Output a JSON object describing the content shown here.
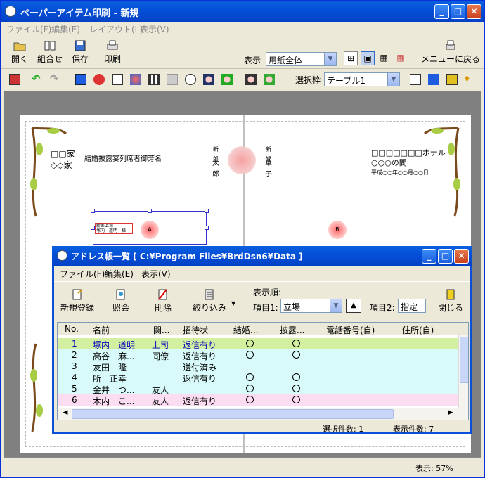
{
  "app": {
    "title": "ペーパーアイテム印刷 - 新規"
  },
  "menu": [
    "ファイル(F)",
    "編集(E)",
    "レイアウト(L)",
    "表示(V)"
  ],
  "toolbar": {
    "open": "開く",
    "combine": "組合せ",
    "save": "保存",
    "print": "印刷",
    "view_label": "表示",
    "view_value": "用紙全体",
    "menu_back": "メニューに戻る"
  },
  "toolbar2": {
    "select_label": "選択枠",
    "select_value": "テーブル1"
  },
  "page": {
    "left_line1": "□□家",
    "left_line2": "◇◇家",
    "left_caption": "結婚披露宴列席者御芳名",
    "groom_title": "新郎",
    "groom_name1": "太",
    "groom_name2": "郎",
    "bride_title": "新婦",
    "bride_name1": "華",
    "bride_name2": "子",
    "hotel_line1": "□□□□□□□ホテル",
    "hotel_line2": "○○○の間",
    "date": "平成○○年○○月○○日",
    "table_a": "A",
    "table_b": "B",
    "seat_title": "新郎上司",
    "seat_name": "塚内　道明　様"
  },
  "sub": {
    "title": "アドレス帳一覧 [ C:¥Program Files¥BrdDsn6¥Data ]",
    "menu": [
      "ファイル(F)",
      "編集(E)",
      "表示(V)"
    ],
    "buttons": {
      "new": "新規登録",
      "lookup": "照会",
      "delete": "削除",
      "filter": "絞り込み",
      "close": "閉じる"
    },
    "order_label": "表示順:",
    "item1_label": "項目1:",
    "item1_value": "立場",
    "item2_label": "項目2:",
    "item2_value": "指定な",
    "columns": [
      "No.",
      "名前",
      "関...",
      "招待状",
      "結婚...",
      "披露...",
      "電話番号(自)",
      "住所(自)"
    ],
    "rows": [
      {
        "no": "1",
        "name": "塚内　道明",
        "rel": "上司",
        "inv": "返信有り",
        "wed": true,
        "rec": true,
        "color": "#d2f0a0",
        "text": "#0000c0"
      },
      {
        "no": "2",
        "name": "高谷　麻...",
        "rel": "同僚",
        "inv": "返信有り",
        "wed": true,
        "rec": true,
        "color": "#d8fafa",
        "text": "#000"
      },
      {
        "no": "3",
        "name": "友田　隆",
        "rel": "",
        "inv": "送付済み",
        "wed": false,
        "rec": false,
        "color": "#d8fafa",
        "text": "#000"
      },
      {
        "no": "4",
        "name": "所　正幸",
        "rel": "",
        "inv": "返信有り",
        "wed": true,
        "rec": true,
        "color": "#d8fafa",
        "text": "#000"
      },
      {
        "no": "5",
        "name": "金井　つ...",
        "rel": "友人",
        "inv": "",
        "wed": true,
        "rec": true,
        "color": "#d8fafa",
        "text": "#000"
      },
      {
        "no": "6",
        "name": "木内　こ...",
        "rel": "友人",
        "inv": "返信有り",
        "wed": true,
        "rec": true,
        "color": "#fbdcf0",
        "text": "#000"
      }
    ],
    "status_selected": "選択件数: 1",
    "status_shown": "表示件数: 7"
  },
  "status": {
    "zoom": "表示: 57%"
  }
}
